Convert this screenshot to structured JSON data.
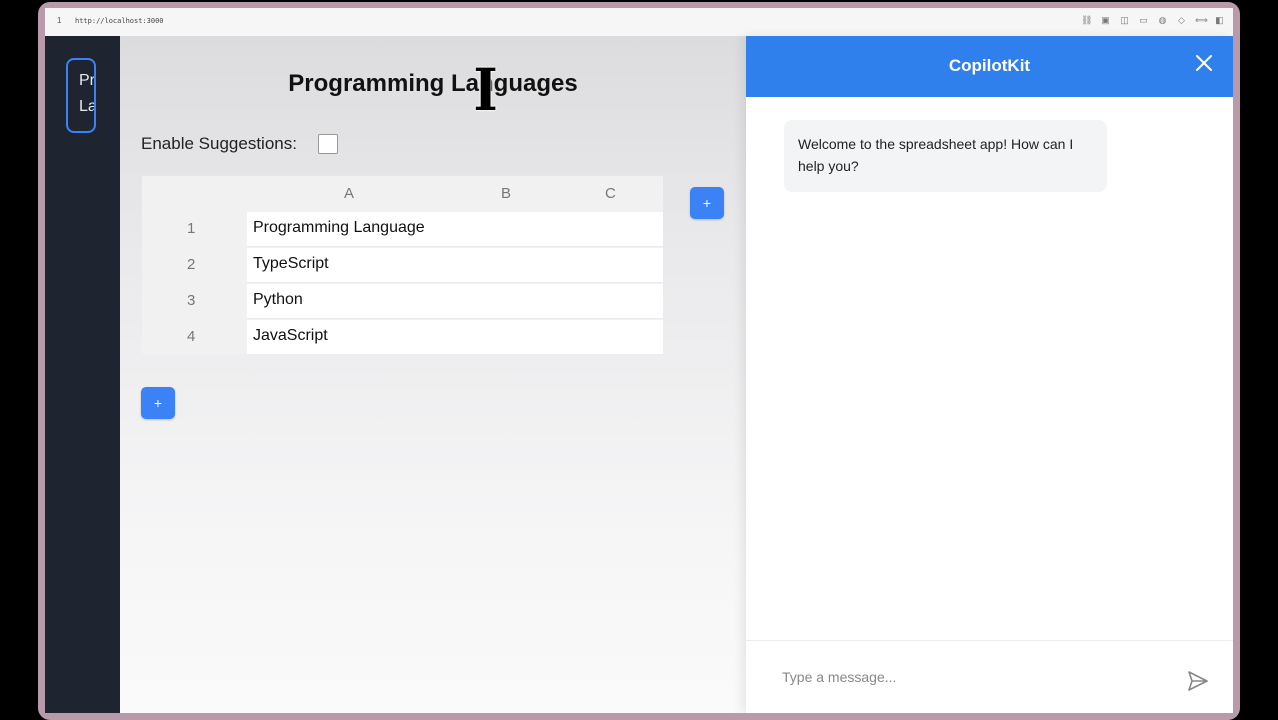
{
  "browser": {
    "tab_number": "1",
    "url": "http://localhost:3000"
  },
  "sidebar": {
    "items": [
      {
        "label_line1": "Prog",
        "label_line2": "Lang"
      }
    ]
  },
  "main": {
    "title": "Programming Languages",
    "suggestions_label": "Enable Suggestions:",
    "suggestions_enabled": false,
    "columns": [
      "A",
      "B",
      "C"
    ],
    "rows": [
      {
        "num": "1",
        "value": "Programming Language"
      },
      {
        "num": "2",
        "value": "TypeScript"
      },
      {
        "num": "3",
        "value": "Python"
      },
      {
        "num": "4",
        "value": "JavaScript"
      }
    ],
    "add_column_label": "+",
    "add_row_label": "+"
  },
  "chat": {
    "title": "CopilotKit",
    "messages": [
      {
        "role": "assistant",
        "text": "Welcome to the spreadsheet app! How can I help you?"
      }
    ],
    "input_placeholder": "Type a message..."
  },
  "colors": {
    "accent": "#3b82f6",
    "chat_header": "#2f80ed",
    "sidebar": "#1e2530"
  }
}
